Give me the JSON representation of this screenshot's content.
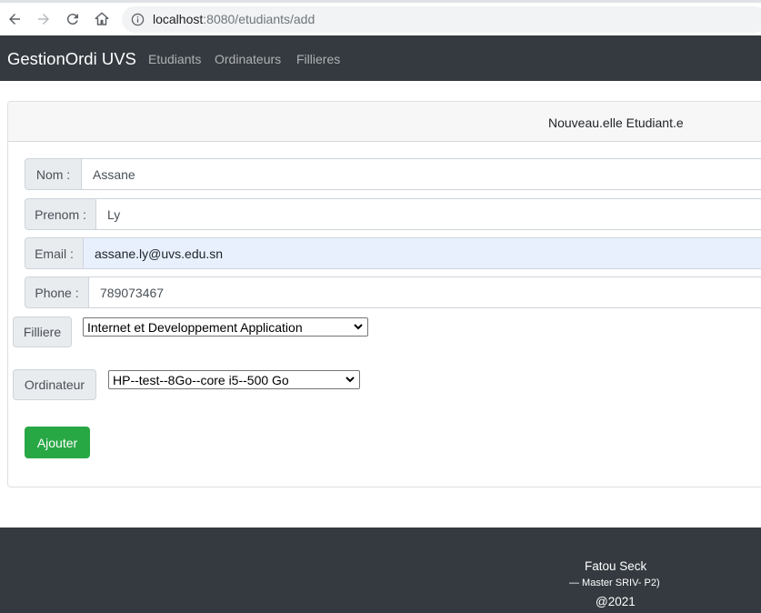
{
  "browser": {
    "url_host": "localhost",
    "url_path": ":8080/etudiants/add"
  },
  "navbar": {
    "brand": "GestionOrdi UVS",
    "links": [
      "Etudiants",
      "Ordinateurs",
      "Fillieres"
    ]
  },
  "card": {
    "title": "Nouveau.elle Etudiant.e"
  },
  "form": {
    "nom": {
      "label": "Nom :",
      "value": "Assane"
    },
    "prenom": {
      "label": "Prenom :",
      "value": "Ly"
    },
    "email": {
      "label": "Email :",
      "value": "assane.ly@uvs.edu.sn"
    },
    "phone": {
      "label": "Phone :",
      "value": "789073467"
    },
    "filliere": {
      "label": "Filliere",
      "selected": "Internet et Developpement Application"
    },
    "ordinateur": {
      "label": "Ordinateur",
      "selected": "HP--test--8Go--core i5--500 Go"
    },
    "submit_label": "Ajouter"
  },
  "footer": {
    "author": "Fatou Seck",
    "program": "—  Master SRIV- P2)",
    "year": "@2021"
  }
}
